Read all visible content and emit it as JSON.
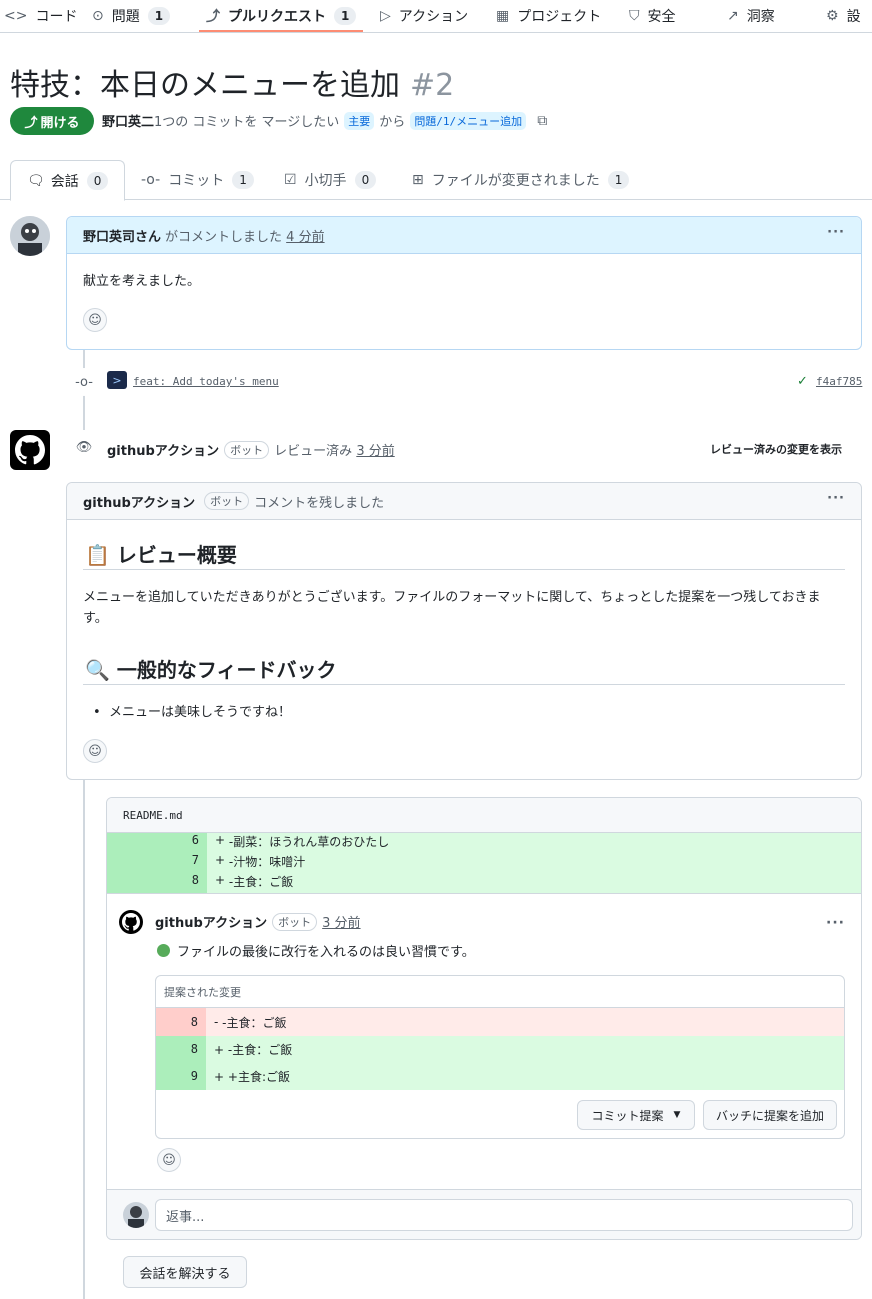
{
  "nav": {
    "items": [
      {
        "icon": "code-icon",
        "glyph": "<>",
        "label": "コード"
      },
      {
        "icon": "issue-icon",
        "glyph": "⊙",
        "label": "問題",
        "count": "1"
      },
      {
        "icon": "pull-request-icon",
        "glyph": "⤴",
        "label": "プルリクエスト",
        "count": "1"
      },
      {
        "icon": "actions-icon",
        "glyph": "▷",
        "label": "アクション"
      },
      {
        "icon": "project-icon",
        "glyph": "▦",
        "label": "プロジェクト"
      },
      {
        "icon": "shield-icon",
        "glyph": "⛉",
        "label": "安全"
      },
      {
        "icon": "graph-icon",
        "glyph": "↗",
        "label": "洞察"
      },
      {
        "icon": "gear-icon",
        "glyph": "⚙",
        "label": "設"
      }
    ]
  },
  "pr": {
    "title": "特技：本日のメニューを追加",
    "number": "#2",
    "state": "開ける",
    "author": "野口英二",
    "meta_text": "1つの コミットを マージしたい",
    "base_branch": "主要",
    "from": "から",
    "head_branch": "問題/1/メニュー追加"
  },
  "tabs": [
    {
      "label": "会話",
      "count": "0"
    },
    {
      "label": "コミット",
      "count": "1"
    },
    {
      "label": "小切手",
      "count": "0"
    },
    {
      "label": "ファイルが変更されました",
      "count": "1"
    }
  ],
  "comment1": {
    "author": "野口英司さん",
    "action": "がコメントしました",
    "time": "4 分前",
    "body": "献立を考えました。",
    "more": "···"
  },
  "commit": {
    "message": "feat: Add today's menu",
    "sha": "f4af785"
  },
  "review_event": {
    "actor": "githubアクション",
    "bot": "ボット",
    "action": "レビュー済み",
    "time": "3 分前",
    "link": "レビュー済みの変更を表示"
  },
  "review": {
    "author": "githubアクション",
    "bot": "ボット",
    "action": "コメントを残しました",
    "more": "···",
    "heading1_emoji": "📋",
    "heading1": "レビュー概要",
    "para": "メニューを追加していただきありがとうございます。ファイルのフォーマットに関して、ちょっとした提案を一つ残しておきます。",
    "heading2_emoji": "🔍",
    "heading2": "一般的なフィードバック",
    "bullet": "メニューは美味しそうですね！"
  },
  "file": {
    "name": "README.md",
    "lines": [
      {
        "num": "6",
        "sign": "+",
        "text": "-副菜：ほうれん草のおひたし"
      },
      {
        "num": "7",
        "sign": "+",
        "text": "-汁物：味噌汁"
      },
      {
        "num": "8",
        "sign": "+",
        "text": "-主食：ご飯"
      }
    ]
  },
  "inline": {
    "author": "githubアクション",
    "bot": "ボット",
    "time": "3 分前",
    "more": "···",
    "body": "ファイルの最後に改行を入れるのは良い習慣です。",
    "suggest_title": "提案された変更",
    "suggestion": [
      {
        "num": "8",
        "sign": "-",
        "text": "-主食：ご飯",
        "type": "del"
      },
      {
        "num": "8",
        "sign": "+",
        "text": "-主食：ご飯",
        "type": "add"
      },
      {
        "num": "9",
        "sign": "+",
        "text": "+主食:ご飯",
        "type": "add"
      }
    ],
    "commit_btn": "コミット提案",
    "batch_btn": "バッチに提案を追加"
  },
  "reply": {
    "placeholder": "返事..."
  },
  "resolve_btn": "会話を解決する"
}
